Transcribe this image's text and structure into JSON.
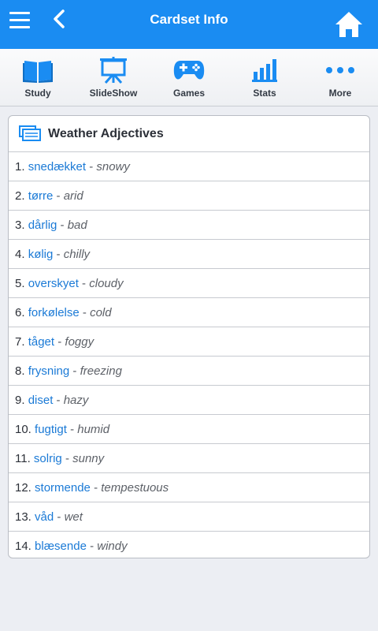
{
  "app": {
    "title": "Cardset Info",
    "accent_color": "#1a8cf2"
  },
  "topbar": {
    "menu_icon": "hamburger-menu-icon",
    "back_icon": "chevron-left-icon",
    "home_icon": "home-icon"
  },
  "toolbar": {
    "items": [
      {
        "label": "Study",
        "icon": "book-icon"
      },
      {
        "label": "SlideShow",
        "icon": "presentation-easel-icon"
      },
      {
        "label": "Games",
        "icon": "gamepad-icon"
      },
      {
        "label": "Stats",
        "icon": "bar-chart-icon"
      },
      {
        "label": "More",
        "icon": "more-dots-icon"
      }
    ]
  },
  "cardset": {
    "icon": "cardset-icon",
    "title": "Weather Adjectives",
    "cards": [
      {
        "num": "1.",
        "term": "snedækket",
        "sep": " - ",
        "def": "snowy"
      },
      {
        "num": "2.",
        "term": "tørre",
        "sep": " - ",
        "def": "arid"
      },
      {
        "num": "3.",
        "term": "dårlig",
        "sep": " - ",
        "def": "bad"
      },
      {
        "num": "4.",
        "term": "kølig",
        "sep": " - ",
        "def": "chilly"
      },
      {
        "num": "5.",
        "term": "overskyet",
        "sep": " - ",
        "def": "cloudy"
      },
      {
        "num": "6.",
        "term": "forkølelse",
        "sep": " - ",
        "def": "cold"
      },
      {
        "num": "7.",
        "term": "tåget",
        "sep": " - ",
        "def": "foggy"
      },
      {
        "num": "8.",
        "term": "frysning",
        "sep": " - ",
        "def": "freezing"
      },
      {
        "num": "9.",
        "term": "diset",
        "sep": " - ",
        "def": "hazy"
      },
      {
        "num": "10.",
        "term": "fugtigt",
        "sep": " - ",
        "def": "humid"
      },
      {
        "num": "11.",
        "term": "solrig",
        "sep": " - ",
        "def": "sunny"
      },
      {
        "num": "12.",
        "term": "stormende",
        "sep": " - ",
        "def": "tempestuous"
      },
      {
        "num": "13.",
        "term": "våd",
        "sep": " - ",
        "def": "wet"
      },
      {
        "num": "14.",
        "term": "blæsende",
        "sep": " - ",
        "def": "windy"
      }
    ]
  }
}
